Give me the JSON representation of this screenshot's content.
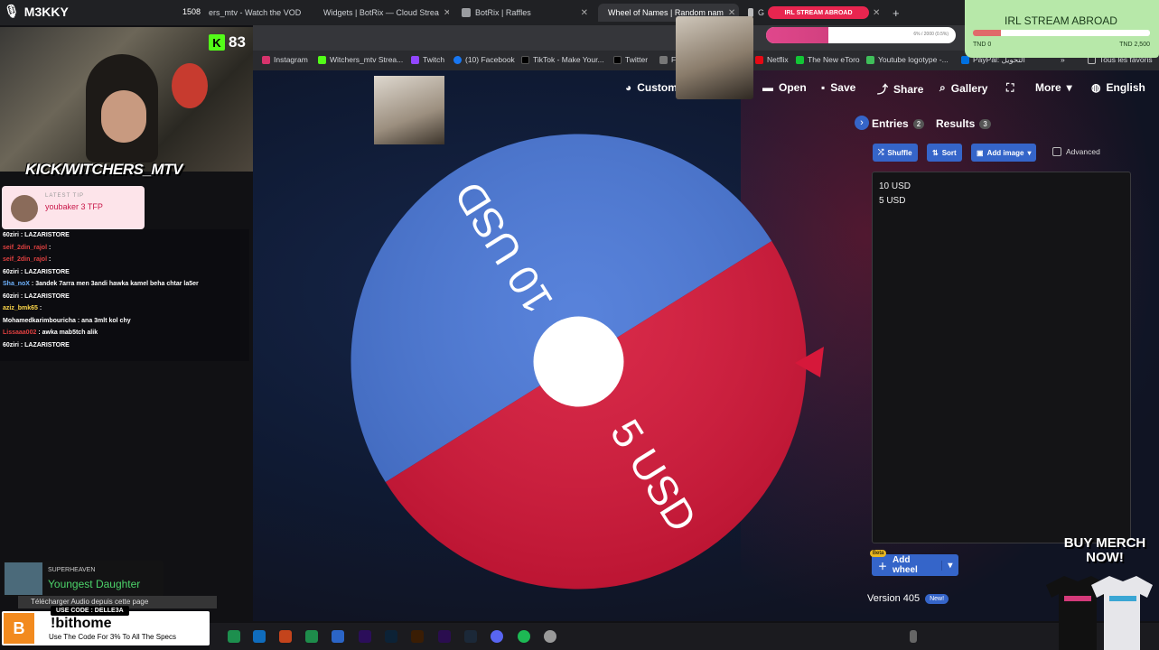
{
  "browser": {
    "tabs": [
      {
        "label": "ers_mtv - Watch the VOD",
        "active": false
      },
      {
        "label": "Widgets | BotRix — Cloud Strea",
        "active": false
      },
      {
        "label": "BotRix | Raffles",
        "active": false
      },
      {
        "label": "Wheel of Names | Random nam",
        "active": true
      },
      {
        "label": "G",
        "active": false
      }
    ],
    "bookmarks": [
      "Instagram",
      "Witchers_mtv Strea...",
      "Twitch",
      "(10) Facebook",
      "TikTok - Make Your...",
      "Twitter",
      "F",
      "Netflix",
      "The New eToro",
      "Youtube logotype -...",
      "PayPal: التحويل",
      "Tous les favoris"
    ]
  },
  "toolbar": {
    "customize": "Customi",
    "open": "Open",
    "save": "Save",
    "share": "Share",
    "gallery": "Gallery",
    "more": "More",
    "language": "English"
  },
  "wheel": {
    "segments": [
      {
        "label": "10 USD",
        "color": "#4a78d8"
      },
      {
        "label": "5 USD",
        "color": "#d6183a"
      }
    ],
    "pointer_color": "#d6183a"
  },
  "panel": {
    "entries_label": "Entries",
    "entries_count": "2",
    "results_label": "Results",
    "results_count": "3",
    "shuffle": "Shuffle",
    "sort": "Sort",
    "add_image": "Add image",
    "advanced": "Advanced",
    "entries": [
      "10 USD",
      "5 USD"
    ],
    "add_wheel": "Add wheel",
    "beta": "Beta",
    "version": "Version 405",
    "new_badge": "New!"
  },
  "stream": {
    "channel": "M3KKY",
    "counter": "1508",
    "viewer_count": "83",
    "kick_handle": "KICK/WITCHERS_MTV",
    "tip_title": "LATEST TIP",
    "tip_text": "youbaker 3 TFP",
    "chat": [
      {
        "user": "60ziri",
        "text": "LAZARISTORE",
        "color": "#ffffff"
      },
      {
        "user": "seif_2din_rajol",
        "text": "",
        "color": "#e04040"
      },
      {
        "user": "seif_2din_rajol",
        "text": "",
        "color": "#e04040"
      },
      {
        "user": "60ziri",
        "text": "LAZARISTORE",
        "color": "#ffffff"
      },
      {
        "user": "Sha_noX",
        "text": "3andek 7arra men 3andi hawka kamel beha chtar la5er",
        "color": "#6fb3ff"
      },
      {
        "user": "60ziri",
        "text": "LAZARISTORE",
        "color": "#ffffff"
      },
      {
        "user": "aziz_bmk65",
        "text": "",
        "color": "#ffd84a"
      },
      {
        "user": "Mohamedkarimbouricha",
        "text": "ana 3mlt kol chy",
        "color": "#ffffff"
      },
      {
        "user": "Lissaaa002",
        "text": "awka mab5tch alik",
        "color": "#e04040"
      },
      {
        "user": "60ziri",
        "text": "LAZARISTORE",
        "color": "#ffffff"
      }
    ],
    "song_artist": "SUPERHEAVEN",
    "song_title": "Youngest Daughter",
    "download_bar": "Télécharger Audio depuis cette page",
    "promo_code": "USE CODE : DELLE3A",
    "promo_title": "!bithome",
    "promo_text": "Use The Code For 3% To All The Specs",
    "goal_title": "IRL STREAM ABROAD",
    "goal_start": "TND 0",
    "goal_end": "TND 2,500",
    "goal_fraction": 0.158,
    "progress_text": "6% / 2000 (0.5%)",
    "progress_fraction": 0.33,
    "merch": "BUY MERCH NOW!"
  }
}
